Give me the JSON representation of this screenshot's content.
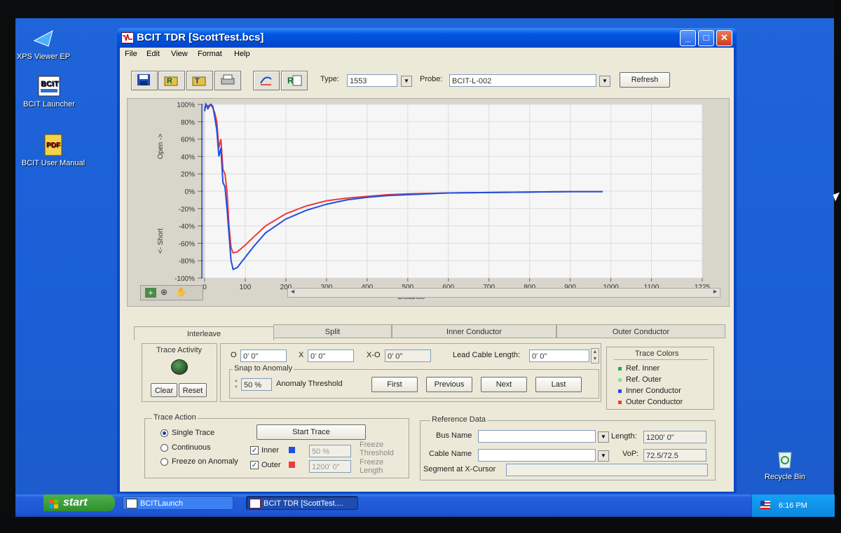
{
  "desktop": {
    "icons": [
      {
        "label": "XPS Viewer EP"
      },
      {
        "label": "BCIT Launcher"
      },
      {
        "label": "BCIT User Manual"
      },
      {
        "label": "Recycle Bin"
      }
    ],
    "bcit_icon_text": "BCIT",
    "pdf_icon_text": "PDF"
  },
  "window": {
    "title": "BCIT TDR [ScottTest.bcs]",
    "menu": [
      "File",
      "Edit",
      "View",
      "Format",
      "Help"
    ],
    "toolbar": {
      "type_label": "Type:",
      "type_value": "1553",
      "probe_label": "Probe:",
      "probe_value": "BCIT-L-002",
      "refresh_label": "Refresh",
      "icons": [
        "save-icon",
        "record-icon",
        "text-export-icon",
        "print-icon",
        "link-icon",
        "report-icon"
      ]
    }
  },
  "chart_data": {
    "type": "line",
    "title": "",
    "xlabel": "Distance",
    "ylabel_top": "Open ->",
    "ylabel_bottom": "<- Short",
    "xlim": [
      0,
      1225
    ],
    "ylim": [
      -100,
      100
    ],
    "x_ticks": [
      "0",
      "100",
      "200",
      "300",
      "400",
      "500",
      "600",
      "700",
      "800",
      "900",
      "1000",
      "1100",
      "1225"
    ],
    "y_ticks": [
      "100%",
      "80%",
      "60%",
      "40%",
      "20%",
      "0%",
      "-20%",
      "-40%",
      "-60%",
      "-80%",
      "-100%"
    ],
    "grid": true,
    "series": [
      {
        "name": "Inner Conductor",
        "color": "#1f4fe0",
        "x": [
          0,
          3,
          8,
          15,
          20,
          25,
          30,
          35,
          40,
          45,
          50,
          55,
          60,
          65,
          70,
          80,
          100,
          120,
          150,
          200,
          250,
          300,
          350,
          400,
          450,
          500,
          550,
          600,
          700,
          800,
          900,
          980
        ],
        "y": [
          92,
          100,
          95,
          100,
          98,
          85,
          70,
          40,
          50,
          10,
          5,
          -20,
          -50,
          -80,
          -90,
          -88,
          -76,
          -64,
          -48,
          -32,
          -22,
          -15,
          -10,
          -7,
          -5,
          -4,
          -3,
          -2,
          -1.5,
          -1,
          -0.5,
          -0.5
        ]
      },
      {
        "name": "Outer Conductor",
        "color": "#ef3a3a",
        "x": [
          0,
          3,
          8,
          15,
          20,
          25,
          30,
          35,
          40,
          45,
          50,
          55,
          60,
          65,
          70,
          80,
          100,
          120,
          150,
          200,
          250,
          300,
          350,
          400,
          450,
          500,
          550,
          600,
          700,
          800,
          900,
          980
        ],
        "y": [
          95,
          100,
          98,
          100,
          96,
          90,
          80,
          50,
          60,
          25,
          20,
          0,
          -40,
          -65,
          -71,
          -70,
          -62,
          -53,
          -40,
          -26,
          -17,
          -11,
          -8,
          -6,
          -4,
          -3,
          -2.5,
          -2,
          -1.5,
          -1,
          -0.5,
          -0.5
        ]
      }
    ]
  },
  "plot_tools": [
    "crosshair-icon",
    "zoom-icon",
    "pan-hand-icon"
  ],
  "tabs": [
    "Interleave",
    "Split",
    "Inner Conductor",
    "Outer Conductor"
  ],
  "trace_activity": {
    "label": "Trace Activity",
    "clear": "Clear",
    "reset": "Reset"
  },
  "cursor": {
    "o_label": "O",
    "o_value": "0' 0\"",
    "x_label": "X",
    "x_value": "0' 0\"",
    "xo_label": "X-O",
    "xo_value": "0' 0\"",
    "lead_label": "Lead Cable Length:",
    "lead_value": "0' 0\"",
    "snap_title": "Snap to Anomaly",
    "threshold_value": "50 %",
    "threshold_label": "Anomaly Threshold",
    "first": "First",
    "previous": "Previous",
    "next": "Next",
    "last": "Last"
  },
  "trace_colors": {
    "title": "Trace Colors",
    "items": [
      {
        "label": "Ref. Inner",
        "color": "#2aa84a"
      },
      {
        "label": "Ref. Outer",
        "color": "#8ee08a"
      },
      {
        "label": "Inner Conductor",
        "color": "#1f4fe0"
      },
      {
        "label": "Outer Conductor",
        "color": "#ef3a3a"
      }
    ]
  },
  "trace_action": {
    "title": "Trace Action",
    "single": "Single Trace",
    "continuous": "Continuous",
    "freeze": "Freeze on Anomaly",
    "start": "Start Trace",
    "inner": "Inner",
    "outer": "Outer",
    "inner_color": "#1f4fe0",
    "outer_color": "#ef3a3a",
    "freeze_threshold_value": "50 %",
    "freeze_threshold_label": "Freeze Threshold",
    "freeze_length_value": "1200' 0\"",
    "freeze_length_label": "Freeze Length"
  },
  "reference": {
    "title": "Reference Data",
    "bus_label": "Bus Name",
    "bus_value": "",
    "cable_label": "Cable Name",
    "cable_value": "",
    "segment_label": "Segment at X-Cursor",
    "segment_value": "",
    "length_label": "Length:",
    "length_value": "1200' 0\"",
    "vop_label": "VoP:",
    "vop_value": "72.5/72.5"
  },
  "taskbar": {
    "start": "start",
    "tasks": [
      "BCITLaunch",
      "BCIT TDR [ScottTest...."
    ],
    "clock": "6:16 PM"
  }
}
